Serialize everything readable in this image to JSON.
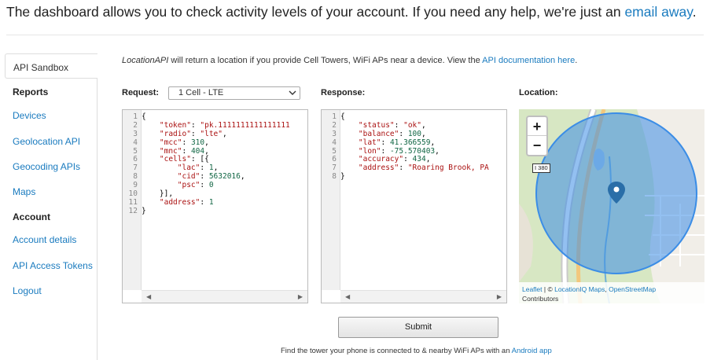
{
  "header": {
    "text": "The dashboard allows you to check activity levels of your account. If you need any help, we're just an",
    "link": "email away",
    "tail": "."
  },
  "sidebar": {
    "tab": "API Sandbox",
    "reports_heading": "Reports",
    "reports_items": [
      "Devices",
      "Geolocation API",
      "Geocoding APIs",
      "Maps"
    ],
    "account_heading": "Account",
    "account_items": [
      "Account details",
      "API Access Tokens",
      "Logout"
    ]
  },
  "intro": {
    "italic": "LocationAPI",
    "text": " will return a location if you provide Cell Towers, WiFi APs near a device. View the ",
    "link": "API documentation here",
    "tail": "."
  },
  "request": {
    "label": "Request:",
    "select_value": "1 Cell - LTE",
    "lines": [
      "{",
      "    \"token\": \"pk.1111111111111111",
      "    \"radio\": \"lte\",",
      "    \"mcc\": 310,",
      "    \"mnc\": 404,",
      "    \"cells\": [{",
      "        \"lac\": 1,",
      "        \"cid\": 5632016,",
      "        \"psc\": 0",
      "    }],",
      "    \"address\": 1",
      "}"
    ]
  },
  "response": {
    "label": "Response:",
    "lines": [
      "{",
      "    \"status\": \"ok\",",
      "    \"balance\": 100,",
      "    \"lat\": 41.366559,",
      "    \"lon\": -75.570403,",
      "    \"accuracy\": 434,",
      "    \"address\": \"Roaring Brook, PA",
      "}"
    ]
  },
  "location": {
    "label": "Location:",
    "zoom_in": "+",
    "zoom_out": "−",
    "road_label": "I 380",
    "attribution_leaflet": "Leaflet",
    "attribution_mid": " | © ",
    "attribution_locationiq": "LocationIQ Maps",
    "attribution_sep": ", ",
    "attribution_osm": "OpenStreetMap",
    "attribution_line2": "Contributors",
    "colors": {
      "accuracy_circle": "#3b8de6",
      "pin": "#2a6ea8"
    }
  },
  "actions": {
    "submit_label": "Submit"
  },
  "footer": {
    "text": "Find the tower your phone is connected to & nearby WiFi APs with an ",
    "link": "Android app"
  }
}
